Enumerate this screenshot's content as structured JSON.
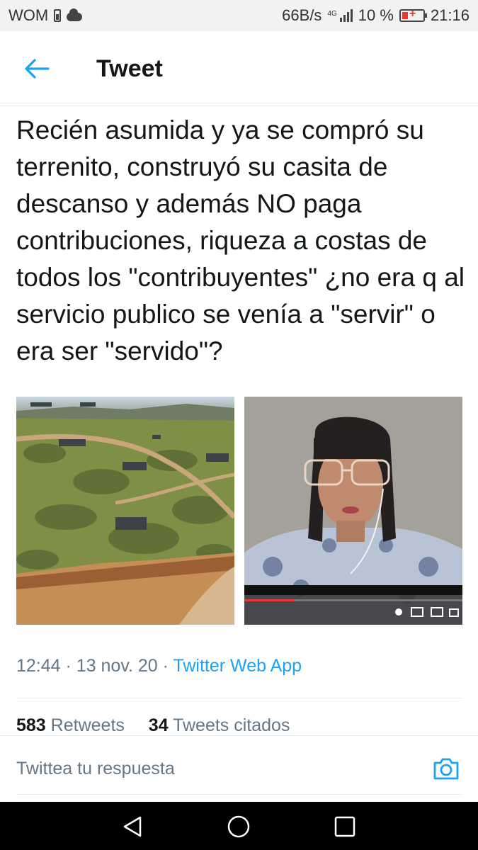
{
  "status_bar": {
    "carrier": "WOM",
    "speed": "66B/s",
    "network": "4G",
    "battery": "10 %",
    "time": "21:16"
  },
  "header": {
    "title": "Tweet"
  },
  "tweet": {
    "text": "Recién asumida y ya se compró su terrenito, construyó su casita de descanso y además NO paga contribuciones, riqueza a costas de todos los \"contribuyentes\" ¿no era q al servicio publico se venía a \"servir\" o era ser \"servido\"?",
    "time": "12:44",
    "date": "13 nov. 20",
    "app": "Twitter Web App",
    "retweets_count": "583",
    "retweets_label": "Retweets",
    "quotes_count": "34",
    "quotes_label": "Tweets citados"
  },
  "media": {
    "items": [
      {
        "type": "aerial-photo"
      },
      {
        "type": "video-frame",
        "progress": 0.23
      }
    ]
  },
  "reply": {
    "placeholder": "Twittea tu respuesta"
  },
  "colors": {
    "accent": "#1da1f2",
    "text": "#14171a",
    "secondary": "#657786"
  }
}
